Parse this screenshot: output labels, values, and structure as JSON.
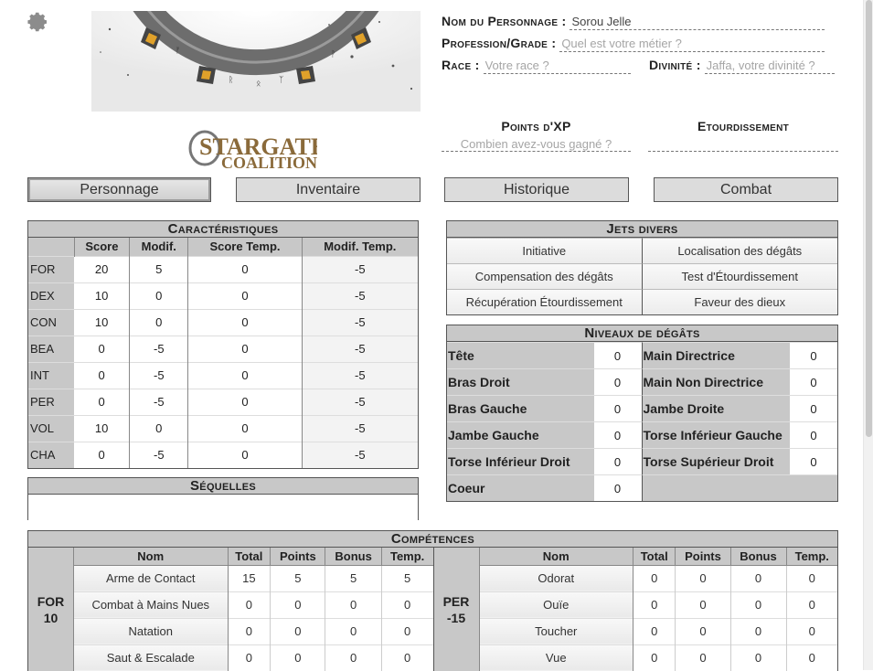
{
  "header": {
    "fields": {
      "nom": {
        "label": "Nom du Personnage :",
        "value": "Sorou Jelle",
        "placeholder": ""
      },
      "profession": {
        "label": "Profession/Grade :",
        "value": "",
        "placeholder": "Quel est votre métier ?"
      },
      "race": {
        "label": "Race :",
        "value": "",
        "placeholder": "Votre race ?"
      },
      "divinite": {
        "label": "Divinité :",
        "value": "",
        "placeholder": "Jaffa, votre divinité ?"
      }
    },
    "xp": {
      "label": "Points d'XP",
      "placeholder": "Combien avez-vous gagné ?"
    },
    "etourdissement": {
      "label": "Etourdissement",
      "placeholder": ""
    },
    "logo": {
      "line1": "STARGATE",
      "line2": "COALITION"
    }
  },
  "tabs": [
    "Personnage",
    "Inventaire",
    "Historique",
    "Combat"
  ],
  "caracteristiques": {
    "title": "Caractéristiques",
    "headers": [
      "",
      "Score",
      "Modif.",
      "Score Temp.",
      "Modif. Temp."
    ],
    "rows": [
      {
        "name": "FOR",
        "score": "20",
        "modif": "5",
        "score_temp": "0",
        "modif_temp": "-5"
      },
      {
        "name": "DEX",
        "score": "10",
        "modif": "0",
        "score_temp": "0",
        "modif_temp": "-5"
      },
      {
        "name": "CON",
        "score": "10",
        "modif": "0",
        "score_temp": "0",
        "modif_temp": "-5"
      },
      {
        "name": "BEA",
        "score": "0",
        "modif": "-5",
        "score_temp": "0",
        "modif_temp": "-5"
      },
      {
        "name": "INT",
        "score": "0",
        "modif": "-5",
        "score_temp": "0",
        "modif_temp": "-5"
      },
      {
        "name": "PER",
        "score": "0",
        "modif": "-5",
        "score_temp": "0",
        "modif_temp": "-5"
      },
      {
        "name": "VOL",
        "score": "10",
        "modif": "0",
        "score_temp": "0",
        "modif_temp": "-5"
      },
      {
        "name": "CHA",
        "score": "0",
        "modif": "-5",
        "score_temp": "0",
        "modif_temp": "-5"
      }
    ]
  },
  "jets": {
    "title": "Jets divers",
    "buttons": [
      "Initiative",
      "Localisation des dégâts",
      "Compensation des dégâts",
      "Test d'Étourdissement",
      "Récupération Étourdissement",
      "Faveur des dieux"
    ]
  },
  "degats": {
    "title": "Niveaux de dégâts",
    "cells": [
      {
        "label": "Tête",
        "value": "0"
      },
      {
        "label": "Main Directrice",
        "value": "0"
      },
      {
        "label": "Bras Droit",
        "value": "0"
      },
      {
        "label": "Main Non Directrice",
        "value": "0"
      },
      {
        "label": "Bras Gauche",
        "value": "0"
      },
      {
        "label": "Jambe Droite",
        "value": "0"
      },
      {
        "label": "Jambe Gauche",
        "value": "0"
      },
      {
        "label": "Torse Inférieur Gauche",
        "value": "0"
      },
      {
        "label": "Torse Inférieur Droit",
        "value": "0"
      },
      {
        "label": "Torse Supérieur Droit",
        "value": "0"
      },
      {
        "label": "Coeur",
        "value": "0"
      }
    ]
  },
  "sequelles": {
    "title": "Séquelles"
  },
  "competences": {
    "title": "Compétences",
    "headers": [
      "Nom",
      "Total",
      "Points",
      "Bonus",
      "Temp."
    ],
    "groups": [
      {
        "attr": "FOR",
        "attr_value": "10",
        "skills": [
          {
            "name": "Arme de Contact",
            "total": "15",
            "points": "5",
            "bonus": "5",
            "temp": "5"
          },
          {
            "name": "Combat à Mains Nues",
            "total": "0",
            "points": "0",
            "bonus": "0",
            "temp": "0"
          },
          {
            "name": "Natation",
            "total": "0",
            "points": "0",
            "bonus": "0",
            "temp": "0"
          },
          {
            "name": "Saut & Escalade",
            "total": "0",
            "points": "0",
            "bonus": "0",
            "temp": "0"
          }
        ]
      },
      {
        "attr": "PER",
        "attr_value": "-15",
        "skills": [
          {
            "name": "Odorat",
            "total": "0",
            "points": "0",
            "bonus": "0",
            "temp": "0"
          },
          {
            "name": "Ouïe",
            "total": "0",
            "points": "0",
            "bonus": "0",
            "temp": "0"
          },
          {
            "name": "Toucher",
            "total": "0",
            "points": "0",
            "bonus": "0",
            "temp": "0"
          },
          {
            "name": "Vue",
            "total": "0",
            "points": "0",
            "bonus": "0",
            "temp": "0"
          }
        ]
      }
    ]
  },
  "colors": {
    "header_grey": "#c8c8c8",
    "border": "#555555",
    "placeholder": "#a5a5a5",
    "logo_brown": "#8a6a3a"
  }
}
